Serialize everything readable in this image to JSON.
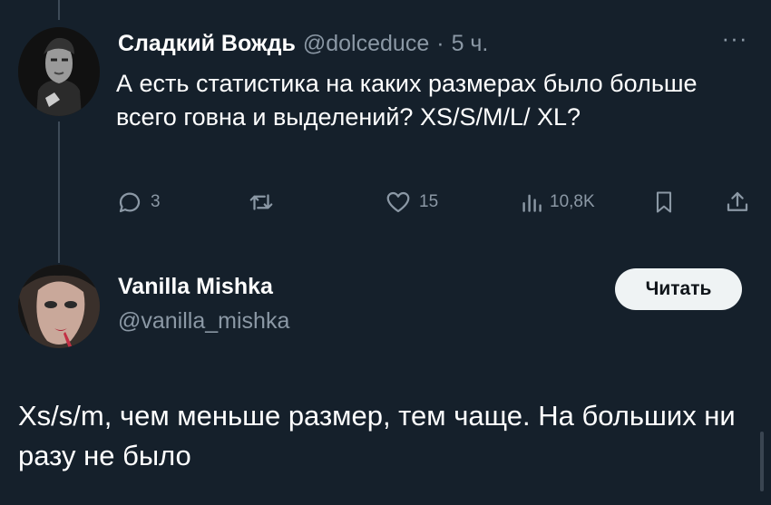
{
  "thread": {
    "tweet": {
      "author_name": "Сладкий Вождь",
      "handle": "@dolceduce",
      "separator": "·",
      "time": "5 ч.",
      "more_label": "···",
      "text": "А есть статистика на каких размерах было больше всего говна и выделений? XS/S/M/L/ XL?",
      "actions": {
        "replies": "3",
        "retweets": "",
        "likes": "15",
        "views": "10,8K"
      }
    },
    "reply": {
      "author_name": "Vanilla Mishka",
      "handle": "@vanilla_mishka",
      "follow_label": "Читать",
      "text": "Xs/s/m, чем меньше размер, тем чаще. На больших ни разу не было"
    }
  },
  "colors": {
    "background": "#15202b",
    "text": "#ffffff",
    "muted": "#8b98a5",
    "button_bg": "#eff3f4"
  }
}
